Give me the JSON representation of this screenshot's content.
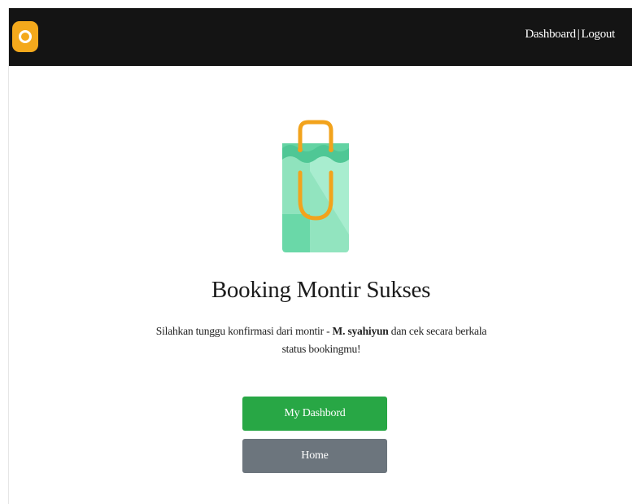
{
  "navbar": {
    "logo": "orange-ring-logo",
    "links": {
      "dashboard": "Dashboard",
      "separator": "|",
      "logout": "Logout"
    }
  },
  "illustration": {
    "icon": "shopping-bag-icon",
    "colors": {
      "bag_light": "#9de8c6",
      "bag_dark": "#54c99a",
      "handle": "#f2a31c"
    }
  },
  "main": {
    "title": "Booking Montir Sukses",
    "message_prefix": "Silahkan tunggu konfirmasi dari montir - ",
    "mechanic_name": "M. syahiyun",
    "message_suffix": " dan cek secara berkala status bookingmu!"
  },
  "buttons": {
    "dashboard_label": "My Dashbord",
    "home_label": "Home"
  },
  "colors": {
    "navbar_bg": "#141414",
    "logo": "#f4a91c",
    "success": "#28a745",
    "secondary": "#6c757d"
  }
}
